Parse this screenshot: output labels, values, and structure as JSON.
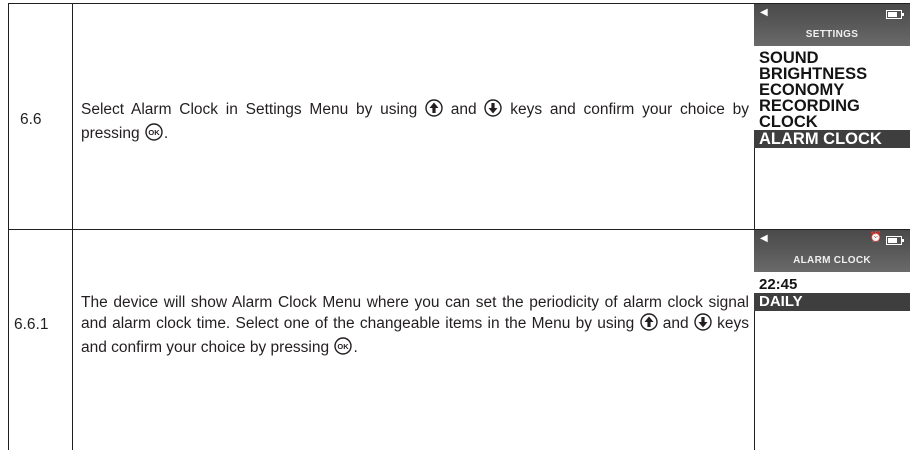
{
  "rows": [
    {
      "step": "6.6",
      "text_parts": [
        "Select Alarm Clock in Settings Menu by using ",
        " and ",
        " keys and confirm your choice by pressing ",
        "."
      ],
      "screen": {
        "title": "SETTINGS",
        "back_icon": "back-arrow-icon",
        "status_icons": [
          "battery-icon"
        ],
        "items": [
          "SOUND",
          "BRIGHTNESS",
          "ECONOMY",
          "RECORDING",
          "CLOCK",
          "ALARM CLOCK"
        ],
        "selected": "ALARM CLOCK"
      }
    },
    {
      "step": "6.6.1",
      "text_parts": [
        "The device will show Alarm Clock Menu where you can set the periodicity of alarm clock signal and alarm clock time. Select one of the changeable items in the Menu by using ",
        " and ",
        " keys and confirm your choice by pressing ",
        "."
      ],
      "screen": {
        "title": "ALARM CLOCK",
        "back_icon": "back-arrow-icon",
        "status_icons": [
          "alarm-bell-icon",
          "battery-icon"
        ],
        "items": [
          "22:45",
          "DAILY"
        ],
        "selected": "DAILY"
      }
    }
  ],
  "icons": {
    "up": "up-arrow-key-icon",
    "down": "down-arrow-key-icon",
    "ok": "ok-key-icon",
    "ok_label": "OK"
  },
  "colors": {
    "text": "#231f20",
    "screen_header": "#595959",
    "selected_bg": "#3e3e3e"
  }
}
